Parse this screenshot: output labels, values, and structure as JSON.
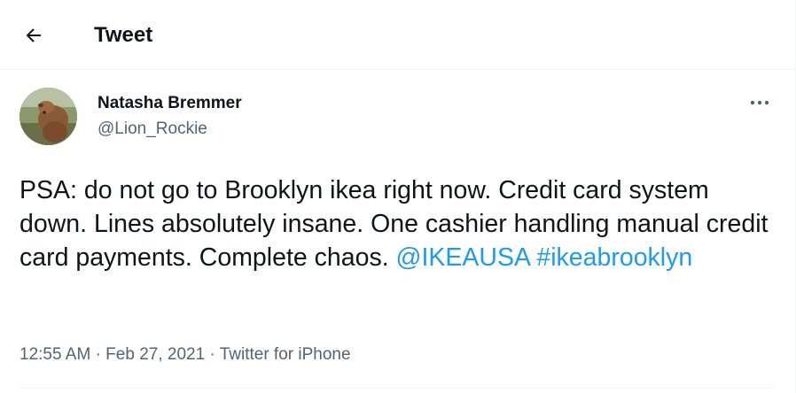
{
  "header": {
    "title": "Tweet",
    "back_icon": "arrow-left-icon"
  },
  "tweet": {
    "author": {
      "name": "Natasha Bremmer",
      "handle": "@Lion_Rockie",
      "avatar_icon": "capybara-avatar"
    },
    "more_icon": "more-horizontal-icon",
    "text_plain": "PSA: do not go to Brooklyn ikea right now. Credit card system down. Lines absolutely insane. One cashier handling manual credit card payments. Complete chaos.",
    "mention": "@IKEAUSA",
    "hashtag": "#ikeabrooklyn",
    "time": "12:55 AM",
    "date": "Feb 27, 2021",
    "separator": "·",
    "source": "Twitter for iPhone",
    "link_color": "#1d9bf0",
    "secondary_text_color": "#536471"
  }
}
